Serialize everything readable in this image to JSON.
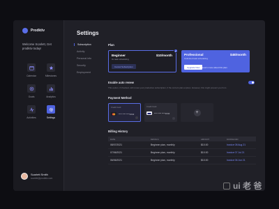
{
  "app": {
    "name": "Prodktiv"
  },
  "welcome": "Welcome Scarlett, Get prodktiv today!",
  "nav": [
    {
      "label": "Calendar",
      "icon": "calendar-icon"
    },
    {
      "label": "Milestones",
      "icon": "star-icon"
    },
    {
      "label": "Goals",
      "icon": "target-icon"
    },
    {
      "label": "Analytics",
      "icon": "chart-icon"
    },
    {
      "label": "Activities",
      "icon": "activity-icon"
    },
    {
      "label": "Settings",
      "icon": "gear-icon",
      "active": true
    }
  ],
  "user": {
    "name": "Scarlett Smith",
    "email": "scarlett@prodktiv.com"
  },
  "page_title": "Settings",
  "subnav": [
    "Subscription",
    "Activity",
    "Personal info",
    "Security",
    "Employment"
  ],
  "plan": {
    "title": "Plan",
    "beginner": {
      "name": "Beginner",
      "price": "$10/month",
      "sub": "3x task scheduling",
      "button": "Cancel Subscription"
    },
    "pro": {
      "name": "Professional",
      "price": "$48/month",
      "sub": "Unlimited task scheduling",
      "button": "Upgrade Now",
      "link": "Learn more about this plan"
    }
  },
  "auto_renew": {
    "title": "Enable auto renew",
    "desc": "This option, if checked, will renew your productive subscription, if the current plan expires. However, this might prevent you from"
  },
  "payment": {
    "title": "Payment Method",
    "cards": [
      {
        "tag": "Credit Card",
        "number": "**** **** ****1642"
      },
      {
        "tag": "Credit Card",
        "number": "**** **** ****1642"
      }
    ],
    "add": "+"
  },
  "billing": {
    "title": "Billing History",
    "columns": [
      "DATE",
      "DETAILS",
      "AMOUNT",
      "DOWNLOAD"
    ],
    "rows": [
      {
        "date": "08/07/2021",
        "details": "Beginner plan, monthly",
        "amount": "$10.00",
        "download": "Invoice 08 Aug 21"
      },
      {
        "date": "07/06/2021",
        "details": "Beginner plan, monthly",
        "amount": "$10.00",
        "download": "Invoice 07 Jul 21"
      },
      {
        "date": "06/06/2021",
        "details": "Beginner plan, monthly",
        "amount": "$10.00",
        "download": "Invoice 06 Jun 21"
      }
    ]
  },
  "watermark": "ui 老 爸",
  "colors": {
    "accent": "#4f63e0",
    "bg": "#202027",
    "sidebar": "#1a1a20"
  }
}
